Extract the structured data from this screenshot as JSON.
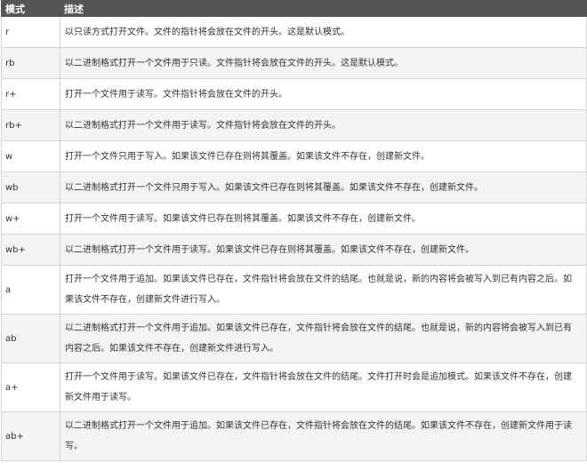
{
  "table": {
    "headers": {
      "mode": "模式",
      "desc": "描述"
    },
    "rows": [
      {
        "mode": "r",
        "desc": "以只读方式打开文件。文件的指针将会放在文件的开头。这是默认模式。"
      },
      {
        "mode": "rb",
        "desc": "以二进制格式打开一个文件用于只读。文件指针将会放在文件的开头。这是默认模式。"
      },
      {
        "mode": "r+",
        "desc": "打开一个文件用于读写。文件指针将会放在文件的开头。"
      },
      {
        "mode": "rb+",
        "desc": "以二进制格式打开一个文件用于读写。文件指针将会放在文件的开头。"
      },
      {
        "mode": "w",
        "desc": "打开一个文件只用于写入。如果该文件已存在则将其覆盖。如果该文件不存在，创建新文件。"
      },
      {
        "mode": "wb",
        "desc": "以二进制格式打开一个文件只用于写入。如果该文件已存在则将其覆盖。如果该文件不存在，创建新文件。"
      },
      {
        "mode": "w+",
        "desc": "打开一个文件用于读写。如果该文件已存在则将其覆盖。如果该文件不存在，创建新文件。"
      },
      {
        "mode": "wb+",
        "desc": "以二进制格式打开一个文件用于读写。如果该文件已存在则将其覆盖。如果该文件不存在，创建新文件。"
      },
      {
        "mode": "a",
        "desc": "打开一个文件用于追加。如果该文件已存在，文件指针将会放在文件的结尾。也就是说，新的内容将会被写入到已有内容之后。如果该文件不存在，创建新文件进行写入。"
      },
      {
        "mode": "ab",
        "desc": "以二进制格式打开一个文件用于追加。如果该文件已存在，文件指针将会放在文件的结尾。也就是说，新的内容将会被写入到已有内容之后。如果该文件不存在，创建新文件进行写入。"
      },
      {
        "mode": "a+",
        "desc": "打开一个文件用于读写。如果该文件已存在，文件指针将会放在文件的结尾。文件打开时会是追加模式。如果该文件不存在，创建新文件用于读写。"
      },
      {
        "mode": "ab+",
        "desc": "以二进制格式打开一个文件用于追加。如果该文件已存在，文件指针将会放在文件的结尾。如果该文件不存在，创建新文件用于读写。"
      }
    ]
  }
}
